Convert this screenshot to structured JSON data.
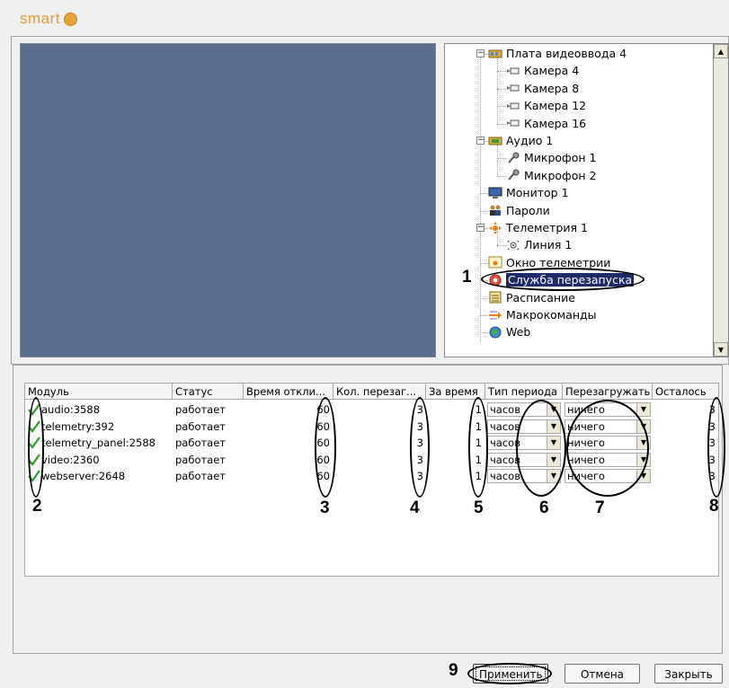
{
  "logo": {
    "text": "smart"
  },
  "tree": {
    "items": [
      {
        "label": "Плата видеоввода 4",
        "icon": "video-board-icon"
      },
      {
        "label": "Камера 4",
        "icon": "camera-icon"
      },
      {
        "label": "Камера 8",
        "icon": "camera-icon"
      },
      {
        "label": "Камера 12",
        "icon": "camera-icon"
      },
      {
        "label": "Камера 16",
        "icon": "camera-icon"
      },
      {
        "label": "Аудио 1",
        "icon": "audio-board-icon"
      },
      {
        "label": "Микрофон 1",
        "icon": "microphone-icon"
      },
      {
        "label": "Микрофон 2",
        "icon": "microphone-icon"
      },
      {
        "label": "Монитор 1",
        "icon": "monitor-icon"
      },
      {
        "label": "Пароли",
        "icon": "users-icon"
      },
      {
        "label": "Телеметрия 1",
        "icon": "telemetry-icon"
      },
      {
        "label": "Линия 1",
        "icon": "line-icon"
      },
      {
        "label": "Окно телеметрии",
        "icon": "telemetry-window-icon"
      },
      {
        "label": "Служба перезапуска",
        "icon": "restart-service-icon"
      },
      {
        "label": "Расписание",
        "icon": "schedule-icon"
      },
      {
        "label": "Макрокоманды",
        "icon": "macro-icon"
      },
      {
        "label": "Web",
        "icon": "web-globe-icon"
      }
    ]
  },
  "table": {
    "headers": [
      "Модуль",
      "Статус",
      "Время откли...",
      "Кол. перезаг...",
      "За время",
      "Тип периода",
      "Перезагружать",
      "Осталось"
    ],
    "rows": [
      {
        "module": "audio:3588",
        "status": "работает",
        "response": "60",
        "count": "3",
        "period": "1",
        "type": "часов",
        "reload": "ничего",
        "left": "3"
      },
      {
        "module": "telemetry:392",
        "status": "работает",
        "response": "60",
        "count": "3",
        "period": "1",
        "type": "часов",
        "reload": "ничего",
        "left": "3"
      },
      {
        "module": "telemetry_panel:2588",
        "status": "работает",
        "response": "60",
        "count": "3",
        "period": "1",
        "type": "часов",
        "reload": "ничего",
        "left": "3"
      },
      {
        "module": "video:2360",
        "status": "работает",
        "response": "60",
        "count": "3",
        "period": "1",
        "type": "часов",
        "reload": "ничего",
        "left": "3"
      },
      {
        "module": "webserver:2648",
        "status": "работает",
        "response": "60",
        "count": "3",
        "period": "1",
        "type": "часов",
        "reload": "ничего",
        "left": "3"
      }
    ]
  },
  "callouts": [
    "1",
    "2",
    "3",
    "4",
    "5",
    "6",
    "7",
    "8",
    "9"
  ],
  "buttons": {
    "apply": "Применить",
    "cancel": "Отмена",
    "close": "Закрыть"
  },
  "colors": {
    "video_bg": "#5a6d8e",
    "selection": "#1f2a6b",
    "logo": "#e89a2c",
    "check": "#2a9d2a"
  }
}
